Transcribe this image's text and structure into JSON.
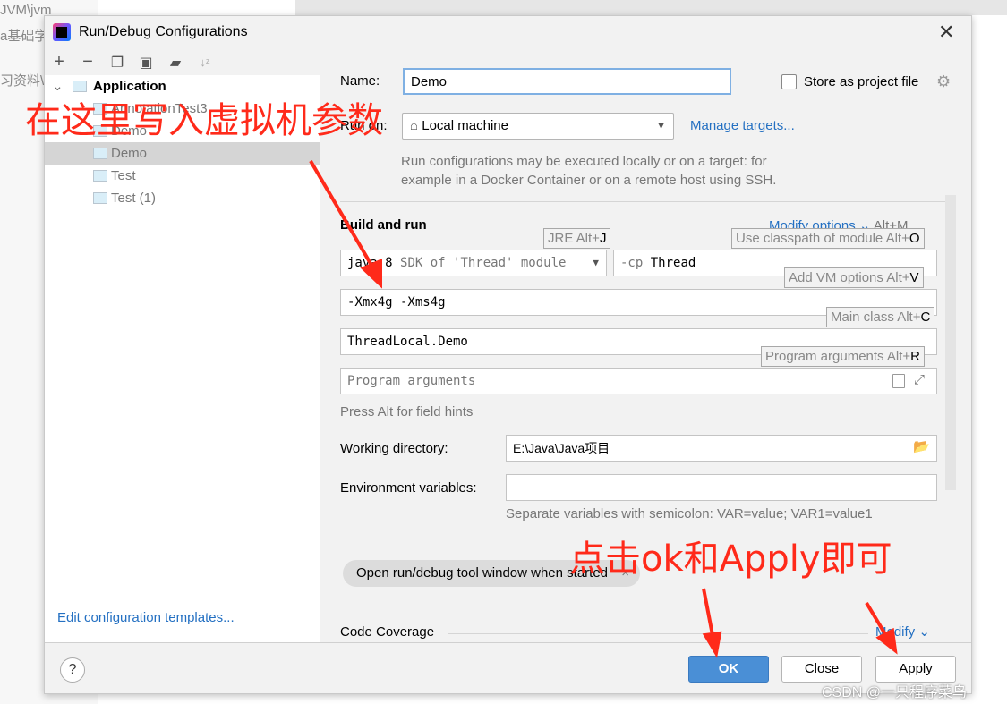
{
  "background": {
    "lines": [
      "JVM\\jvm",
      "a基础学",
      "习资料\\J"
    ]
  },
  "dialog": {
    "title": "Run/Debug Configurations",
    "close_icon": "close-icon"
  },
  "toolbar": {
    "icons": [
      "plus-icon",
      "minus-icon",
      "copy-icon",
      "save-icon",
      "new-folder-icon",
      "sort-az-icon"
    ]
  },
  "tree": {
    "root": "Application",
    "items": [
      {
        "label": "AnnotationTest3",
        "selected": false
      },
      {
        "label": "Demo",
        "selected": false
      },
      {
        "label": "Demo",
        "selected": true
      },
      {
        "label": "Test",
        "selected": false
      },
      {
        "label": "Test (1)",
        "selected": false
      }
    ]
  },
  "edit_templates": "Edit configuration templates...",
  "form": {
    "name_label": "Name:",
    "name_value": "Demo",
    "store_label": "Store as project file",
    "store_checked": false,
    "run_on_label": "Run on:",
    "run_on_value": "Local machine",
    "manage_targets": "Manage targets...",
    "run_on_desc1": "Run configurations may be executed locally or on a target: for",
    "run_on_desc2": "example in a Docker Container or on a remote host using SSH.",
    "build_run": "Build and run",
    "modify_options": "Modify options",
    "modify_shortcut": "Alt+M",
    "jre_main": "java 8",
    "jre_sub": "SDK of 'Thread' module",
    "cp_prefix": "-cp",
    "cp_value": "Thread",
    "vm_options": "-Xmx4g  -Xms4g",
    "main_class": "ThreadLocal.Demo",
    "program_args_placeholder": "Program arguments",
    "field_hints_note": "Press Alt for field hints",
    "working_dir_label": "Working directory:",
    "working_dir_value": "E:\\Java\\Java项目",
    "env_label": "Environment variables:",
    "env_value": "",
    "env_note": "Separate variables with semicolon: VAR=value; VAR1=value1",
    "tag_label": "Open run/debug tool window when started",
    "code_coverage": "Code Coverage",
    "modify": "Modify"
  },
  "hints": {
    "jre": {
      "text": "JRE Alt+",
      "key": "J"
    },
    "classpath": {
      "text": "Use classpath of module Alt+",
      "key": "O"
    },
    "vm": {
      "text": "Add VM options Alt+",
      "key": "V"
    },
    "main": {
      "text": "Main class Alt+",
      "key": "C"
    },
    "args": {
      "text": "Program arguments Alt+",
      "key": "R"
    }
  },
  "buttons": {
    "ok": "OK",
    "close": "Close",
    "apply": "Apply",
    "help": "?"
  },
  "annotations": {
    "top": "在这里写入虚拟机参数",
    "bottom": "点击ok和Apply即可",
    "color": "#ff2a1a"
  },
  "watermark": "CSDN @一只程序菜鸟",
  "colors": {
    "accent": "#4a8fd6",
    "link": "#2470c2"
  }
}
